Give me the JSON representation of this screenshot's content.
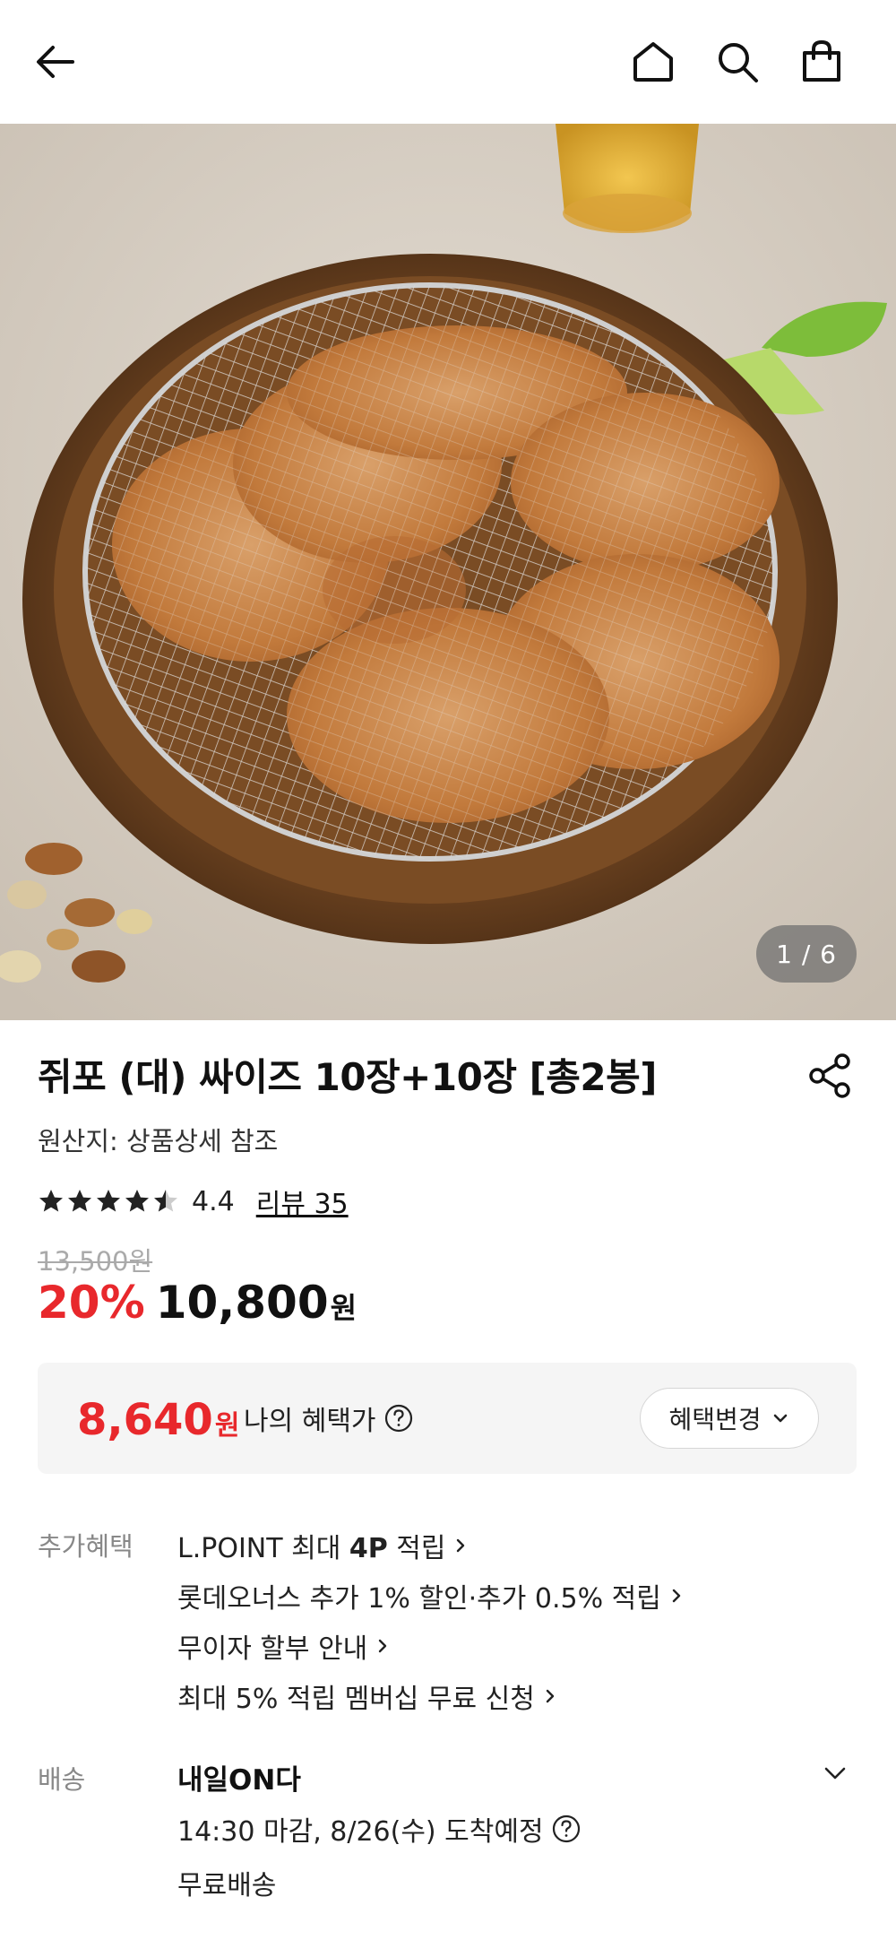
{
  "header": {
    "icons": [
      "back-arrow-icon",
      "home-icon",
      "search-icon",
      "shopping-bag-icon"
    ]
  },
  "gallery": {
    "counter": "1 / 6"
  },
  "product": {
    "title": "쥐포 (대) 싸이즈 10장+10장 [총2봉]",
    "origin": "원산지: 상품상세 참조",
    "rating": "4.4",
    "rating_value": 4.4,
    "review_link": "리뷰 35",
    "original_price": "13,500원",
    "discount": "20%",
    "price": "10,800",
    "price_unit": "원"
  },
  "benefit_box": {
    "price": "8,640",
    "unit": "원",
    "label": "나의 혜택가",
    "change_button": "혜택변경"
  },
  "extra_benefits": {
    "label": "추가혜택",
    "items": [
      {
        "prefix": "L.POINT 최대 ",
        "bold": "4P",
        "suffix": " 적립"
      },
      {
        "prefix": "롯데오너스 추가 1% 할인·추가 0.5% 적립",
        "bold": "",
        "suffix": ""
      },
      {
        "prefix": "무이자 할부 안내",
        "bold": "",
        "suffix": ""
      },
      {
        "prefix": "최대 5% 적립 멤버십 무료 신청",
        "bold": "",
        "suffix": ""
      }
    ]
  },
  "delivery": {
    "label": "배송",
    "title": "내일ON다",
    "time": "14:30 마감, 8/26(수) 도착예정",
    "free": "무료배송"
  },
  "colors": {
    "accent_red": "#e8282c",
    "muted": "#888888",
    "box_bg": "#f5f5f5"
  }
}
